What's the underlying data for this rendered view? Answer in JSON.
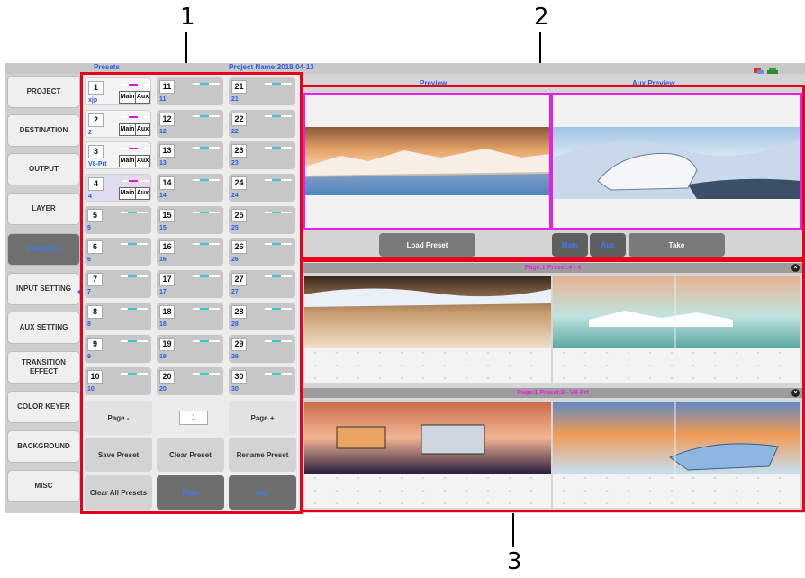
{
  "callouts": [
    "1",
    "2",
    "3"
  ],
  "header": {
    "presets_title": "Presets",
    "project_name": "Project Name:2018-04-13",
    "preview_label": "Preview",
    "aux_preview_label": "Aux Preview"
  },
  "sidebar": {
    "items": [
      {
        "label": "PROJECT"
      },
      {
        "label": "DESTINATION"
      },
      {
        "label": "OUTPUT"
      },
      {
        "label": "LAYER"
      },
      {
        "label": "PRESETS",
        "active": true
      },
      {
        "label": "INPUT SETTING"
      },
      {
        "label": "AUX SETTING"
      },
      {
        "label": "TRANSITION EFFECT"
      },
      {
        "label": "COLOR KEYER"
      },
      {
        "label": "BACKGROUND"
      },
      {
        "label": "MISC"
      }
    ]
  },
  "presets": {
    "cells": [
      {
        "num": "1",
        "sub": "xjp",
        "main_aux": true
      },
      {
        "num": "2",
        "sub": "2",
        "main_aux": true
      },
      {
        "num": "3",
        "sub": "V8-Prt",
        "main_aux": true
      },
      {
        "num": "4",
        "sub": "4",
        "main_aux": true,
        "selected": true
      },
      {
        "num": "5",
        "sub": "5"
      },
      {
        "num": "6",
        "sub": "6"
      },
      {
        "num": "7",
        "sub": "7"
      },
      {
        "num": "8",
        "sub": "8"
      },
      {
        "num": "9",
        "sub": "9"
      },
      {
        "num": "10",
        "sub": "10"
      },
      {
        "num": "11",
        "sub": "11"
      },
      {
        "num": "12",
        "sub": "12"
      },
      {
        "num": "13",
        "sub": "13"
      },
      {
        "num": "14",
        "sub": "14"
      },
      {
        "num": "15",
        "sub": "15"
      },
      {
        "num": "16",
        "sub": "16"
      },
      {
        "num": "17",
        "sub": "17"
      },
      {
        "num": "18",
        "sub": "18"
      },
      {
        "num": "19",
        "sub": "19"
      },
      {
        "num": "20",
        "sub": "20"
      },
      {
        "num": "21",
        "sub": "21"
      },
      {
        "num": "22",
        "sub": "22"
      },
      {
        "num": "23",
        "sub": "23"
      },
      {
        "num": "24",
        "sub": "24"
      },
      {
        "num": "25",
        "sub": "25"
      },
      {
        "num": "26",
        "sub": "26"
      },
      {
        "num": "27",
        "sub": "27"
      },
      {
        "num": "28",
        "sub": "28"
      },
      {
        "num": "29",
        "sub": "29"
      },
      {
        "num": "30",
        "sub": "30"
      }
    ],
    "main_label": "Main",
    "aux_label": "Aux",
    "page_minus": "Page -",
    "page_value": "1",
    "page_plus": "Page +",
    "save": "Save Preset",
    "clear": "Clear Preset",
    "rename": "Rename Preset",
    "clear_all": "Clear All Presets",
    "main_toggle": "Main",
    "aux_toggle": "Aux"
  },
  "preview": {
    "load_preset": "Load Preset",
    "main": "Main",
    "aux": "Aux",
    "take": "Take"
  },
  "groups": [
    {
      "header": "Page:1    Preset:4 - 4"
    },
    {
      "header": "Page:1    Preset:3 - V8-Prt"
    }
  ],
  "colors": {
    "highlight": "#e8001c",
    "magenta": "#e81fe8",
    "link_blue": "#2d5be3"
  }
}
